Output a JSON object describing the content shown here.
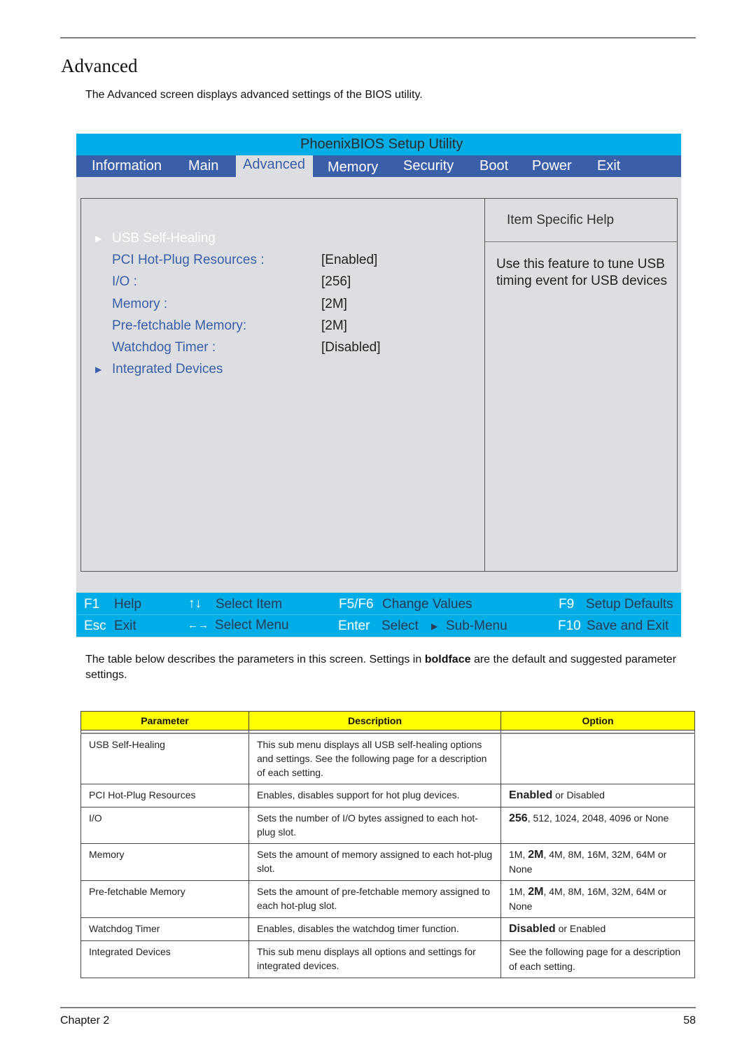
{
  "page": {
    "title": "Advanced",
    "intro": "The Advanced screen displays advanced settings of the BIOS utility.",
    "after_text_before_bold": "The table below describes the parameters in this screen. Settings in ",
    "after_text_bold": "boldface",
    "after_text_after_bold": " are the default and suggested parameter settings.",
    "footer_left": "Chapter 2",
    "footer_right": "58"
  },
  "bios": {
    "title": "PhoenixBIOS Setup Utility",
    "tabs": [
      {
        "label": "Information",
        "active": false
      },
      {
        "label": "Main",
        "active": false
      },
      {
        "label": "Advanced",
        "active": true
      },
      {
        "label": "Memory",
        "active": false
      },
      {
        "label": "Security",
        "active": false
      },
      {
        "label": "Boot",
        "active": false
      },
      {
        "label": "Power",
        "active": false
      },
      {
        "label": "Exit",
        "active": false
      }
    ],
    "items": [
      {
        "label": "USB Self-Healing",
        "value": "",
        "submenu": true,
        "highlighted": true
      },
      {
        "label": "PCI Hot-Plug Resources :",
        "value": "[Enabled]",
        "submenu": false
      },
      {
        "label": "I/O :",
        "value": "[256]",
        "submenu": false
      },
      {
        "label": "Memory :",
        "value": "[2M]",
        "submenu": false
      },
      {
        "label": "Pre-fetchable Memory:",
        "value": "[2M]",
        "submenu": false
      },
      {
        "label": "Watchdog Timer :",
        "value": "[Disabled]",
        "submenu": false
      },
      {
        "label": "Integrated Devices",
        "value": "",
        "submenu": true
      }
    ],
    "submenu_arrow": "▶",
    "help": {
      "heading": "Item Specific Help",
      "text": "Use this feature to tune USB timing event for USB devices"
    },
    "footer": {
      "f1_key": "F1",
      "f1_desc": "Help",
      "updown_key": "↑↓",
      "updown_desc": "Select Item",
      "f5f6_key": "F5/F6",
      "f5f6_desc": "Change Values",
      "f9_key": "F9",
      "f9_desc": "Setup Defaults",
      "esc_key": "Esc",
      "esc_desc": "Exit",
      "leftright_key": "←→",
      "leftright_desc": "Select Menu",
      "enter_key": "Enter",
      "enter_desc": "Select",
      "submenu_arrow": "▶",
      "submenu_desc": "Sub-Menu",
      "f10_key": "F10",
      "f10_desc": "Save and Exit"
    },
    "colors": {
      "title_bar": "#00ade6",
      "menu_bar": "#3b5ea8",
      "background": "#dcdee2",
      "item_text": "#3b5ea8"
    }
  },
  "table": {
    "headers": [
      "Parameter",
      "Description",
      "Option"
    ],
    "rows": [
      {
        "parameter": "USB Self-Healing",
        "description": "This sub menu displays all USB self-healing options and settings. See the following page for a description of each setting.",
        "option_bold": "",
        "option_rest": ""
      },
      {
        "parameter": "PCI Hot-Plug Resources",
        "description": "Enables, disables support for hot plug devices.",
        "option_pre": "",
        "option_bold": "Enabled",
        "option_rest": " or Disabled"
      },
      {
        "parameter": "I/O",
        "description": "Sets the number of I/O bytes assigned to each hot-plug slot.",
        "option_pre": "",
        "option_bold": "256",
        "option_rest": ", 512, 1024, 2048, 4096 or None"
      },
      {
        "parameter": "Memory",
        "description": "Sets the amount of memory assigned to each hot-plug slot.",
        "option_pre": "1M, ",
        "option_bold": "2M",
        "option_rest": ", 4M, 8M, 16M, 32M, 64M or None"
      },
      {
        "parameter": "Pre-fetchable Memory",
        "description": "Sets the amount of pre-fetchable memory assigned to each hot-plug slot.",
        "option_pre": "1M, ",
        "option_bold": "2M",
        "option_rest": ", 4M, 8M, 16M, 32M, 64M or None"
      },
      {
        "parameter": "Watchdog Timer",
        "description": "Enables, disables the watchdog timer function.",
        "option_pre": "",
        "option_bold": "Disabled",
        "option_rest": " or Enabled"
      },
      {
        "parameter": "Integrated Devices",
        "description": "This sub menu displays all options and settings for integrated devices.",
        "option_pre": "",
        "option_bold": "",
        "option_rest": "See the following page for a description of each setting."
      }
    ]
  }
}
